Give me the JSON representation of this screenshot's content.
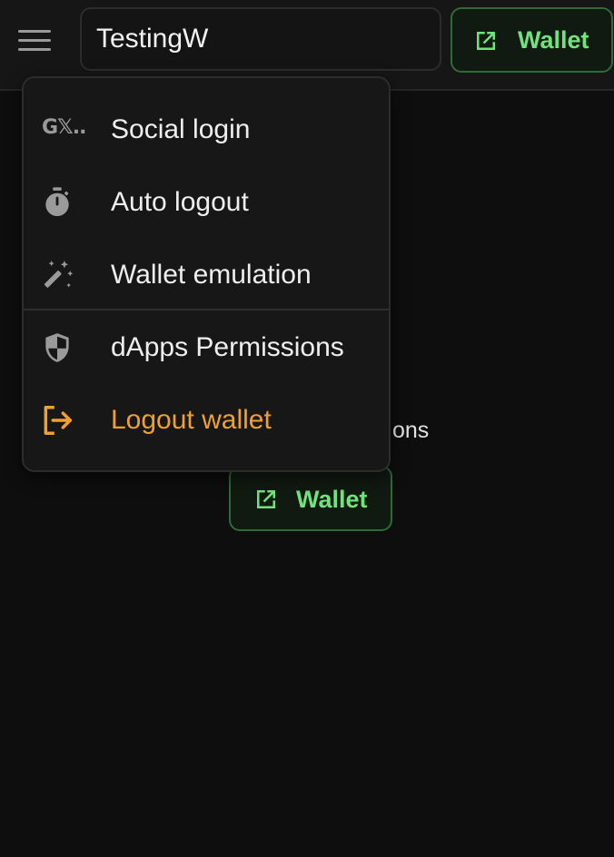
{
  "header": {
    "title_value": "TestingW",
    "wallet_button_label": "Wallet"
  },
  "content": {
    "partial_text": "ons",
    "wallet_button_label": "Wallet"
  },
  "menu": {
    "items": [
      {
        "label": "Social login",
        "icon": "social-login-icon"
      },
      {
        "label": "Auto logout",
        "icon": "stopwatch-icon"
      },
      {
        "label": "Wallet emulation",
        "icon": "magic-wand-icon"
      },
      {
        "label": "dApps Permissions",
        "icon": "shield-icon"
      },
      {
        "label": "Logout wallet",
        "icon": "logout-icon"
      }
    ],
    "social_icon_text": "G𝕏.."
  },
  "colors": {
    "accent_green": "#72e27d",
    "danger_orange": "#f0a030",
    "background": "#0e0e0e"
  }
}
